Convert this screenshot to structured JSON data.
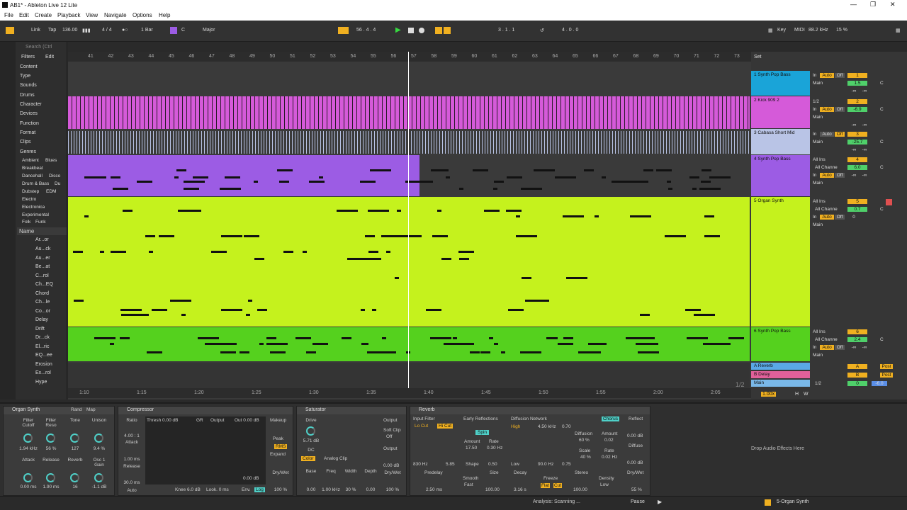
{
  "window": {
    "title": "AB1* - Ableton Live 12 Lite"
  },
  "menu": [
    "File",
    "Edit",
    "Create",
    "Playback",
    "View",
    "Navigate",
    "Options",
    "Help"
  ],
  "control": {
    "link": "Link",
    "tap": "Tap",
    "tempo": "136.00",
    "signature": "4 / 4",
    "quantize": "1 Bar",
    "key": "C",
    "scale": "Major",
    "position": "56 .  4 .  4",
    "loop_start": "3 .  1 .  1",
    "loop_length": "4 .  0 .  0",
    "key_btn": "Key",
    "midi": "MIDI",
    "sample_rate": "88.2 kHz",
    "cpu": "15 %"
  },
  "browser": {
    "search": "Search (Ctrl",
    "filters": "Filters",
    "edit": "Edit",
    "categories": [
      "Content",
      "Type",
      "Sounds",
      "Drums",
      "Character",
      "Devices",
      "Function",
      "Format",
      "Clips",
      "Genres"
    ],
    "genres": [
      "Ambient",
      "Blues",
      "Breakbeat",
      "Dancehall",
      "Disco",
      "Drum & Bass",
      "Du",
      "Dubstep",
      "EDM",
      "Electro",
      "Electronica",
      "Experimental",
      "Folk",
      "Funk"
    ],
    "name_header": "Name",
    "items": [
      "Ar...or",
      "Au...ck",
      "Au...er",
      "Be...at",
      "C...rol",
      "Ch...EQ",
      "Chord",
      "Ch...le",
      "Co...or",
      "Delay",
      "Drift",
      "Dr...ck",
      "El...ric",
      "EQ...ee",
      "Erosion",
      "Ex...rol",
      "Hype"
    ]
  },
  "ruler": [
    "41",
    "42",
    "43",
    "44",
    "45",
    "46",
    "47",
    "48",
    "49",
    "50",
    "51",
    "52",
    "53",
    "54",
    "55",
    "56",
    "57",
    "58",
    "59",
    "60",
    "61",
    "62",
    "63",
    "64",
    "65",
    "66",
    "67",
    "68",
    "69",
    "70",
    "71",
    "72",
    "73"
  ],
  "time_ruler": [
    "1:10",
    "1:15",
    "1:20",
    "1:25",
    "1:30",
    "1:35",
    "1:40",
    "1:45",
    "1:50",
    "1:55",
    "2:00",
    "2:05"
  ],
  "page_indicator": "1/2",
  "set_label": "Set",
  "tracks": [
    {
      "num": "1",
      "name": "1 Synth Pop Bass",
      "color": "#1aa4d8",
      "input": "In",
      "auto": "Auto",
      "off": "Off",
      "vol": "1.5",
      "pan": "C",
      "route": "Main",
      "inf1": "-∞",
      "inf2": "-∞"
    },
    {
      "num": "2",
      "name": "2 Kick 909 2",
      "color": "#d55ad9",
      "input": "1/2",
      "auto": "Auto",
      "off": "Off",
      "vol": "-6.9",
      "pan": "C",
      "route": "Main",
      "in": "In",
      "inf1": "-∞",
      "inf2": "-∞"
    },
    {
      "num": "3",
      "name": "3 Cabasa Short Mid",
      "color": "#b9c4e6",
      "input": "In",
      "auto": "Auto",
      "off": "Off",
      "vol": "-25.7",
      "pan": "C",
      "route": "Main",
      "inf1": "-∞",
      "inf2": "-∞"
    },
    {
      "num": "4",
      "name": "4 Synth Pop Bass",
      "color": "#9c5ce4",
      "input": "All Ins",
      "channel": "All Channe",
      "auto": "Auto",
      "off": "Off",
      "vol": "6.0",
      "pan": "C",
      "route": "Main",
      "in": "In",
      "inf1": "-∞",
      "inf2": "-∞"
    },
    {
      "num": "5",
      "name": "5 Organ Synth",
      "color": "#c5f21d",
      "input": "All Ins",
      "channel": "All Channe",
      "auto": "Auto",
      "off": "Off",
      "vol": "0.7",
      "pan": "C",
      "route": "Main",
      "in": "In",
      "inf1": "0"
    },
    {
      "num": "6",
      "name": "6 Synth Pop Bass",
      "color": "#55d11e",
      "input": "All Ins",
      "channel": "All Channe",
      "auto": "Auto",
      "off": "Off",
      "vol": "2.4",
      "pan": "C",
      "route": "Main",
      "in": "In",
      "inf1": "-∞",
      "inf2": "-∞"
    }
  ],
  "returns": [
    {
      "name": "A Reverb",
      "letter": "A",
      "color": "#5aa8e6",
      "post": "Post"
    },
    {
      "name": "B Delay",
      "letter": "B",
      "color": "#e0609a",
      "post": "Post"
    }
  ],
  "master": {
    "name": "Main",
    "route": "1/2",
    "vol": "0",
    "pan": "-6.0",
    "zoom": "1.00x",
    "h": "H",
    "w": "W"
  },
  "devices": {
    "rack": {
      "title": "Organ Synth",
      "rand": "Rand",
      "map": "Map",
      "macros": [
        {
          "l": "Filter Cutoff",
          "v": "1.94 kHz"
        },
        {
          "l": "Filter Reso",
          "v": "56 %"
        },
        {
          "l": "Tone",
          "v": "127"
        },
        {
          "l": "Unison",
          "v": "9.4 %"
        },
        {
          "l": "Attack",
          "v": "0.00 ms"
        },
        {
          "l": "Release",
          "v": "1.90 ms"
        },
        {
          "l": "Reverb",
          "v": "16"
        },
        {
          "l": "Osc 1 Gain",
          "v": "-1.1 dB"
        }
      ]
    },
    "compressor": {
      "title": "Compressor",
      "ratio_l": "Ratio",
      "ratio": "4.00 : 1",
      "attack_l": "Attack",
      "attack": "1.00 ms",
      "release_l": "Release",
      "release": "30.0 ms",
      "auto": "Auto",
      "thresh": "Thresh 0.00 dB",
      "gr": "GR",
      "output": "Output",
      "out": "Out 0.00 dB",
      "makeup": "Makeup",
      "peak": "Peak",
      "rms": "RMS",
      "expand": "Expand",
      "knee": "Knee 6.0 dB",
      "look": "Look. 0 ms",
      "env": "Env.",
      "log": "Log",
      "drywet_l": "Dry/Wet",
      "drywet": "100 %",
      "level": "0.00 dB"
    },
    "saturator": {
      "title": "Saturator",
      "drive_l": "Drive",
      "drive": "5.71 dB",
      "dc": "DC",
      "color": "Color",
      "mode": "Analog Clip",
      "output_l": "Output",
      "softclip": "Soft Clip",
      "off": "Off",
      "output": "0.00 dB",
      "base_l": "Base",
      "base": "0.00",
      "freq_l": "Freq",
      "freq": "1.00 kHz",
      "width_l": "Width",
      "width": "30 %",
      "depth_l": "Depth",
      "depth": "0.00",
      "drywet_l": "Dry/Wet",
      "drywet": "100 %"
    },
    "reverb": {
      "title": "Reverb",
      "input_filter": "Input Filter",
      "locut": "Lo Cut",
      "hicut": "Hi Cut",
      "hz": "830 Hz",
      "q": "5.85",
      "early": "Early Reflections",
      "spin": "Spin",
      "amount_l": "Amount",
      "amount": "17.50",
      "rate_l": "Rate",
      "rate": "0.30 Hz",
      "shape_l": "Shape",
      "shape": "0.50",
      "diffusion_net": "Diffusion Network",
      "high": "High",
      "hz2": "4.50 kHz",
      "v070": "0.70",
      "low": "Low",
      "hz3": "90.0 Hz",
      "v075": "0.75",
      "diffusion_l": "Diffusion",
      "diffusion": "60 %",
      "scale_l": "Scale",
      "scale": "40 %",
      "chorus": "Chorus",
      "camount_l": "Amount",
      "camount": "0.02",
      "crate_l": "Rate",
      "crate": "0.02 Hz",
      "reflect_l": "Reflect",
      "reflect": "0.00 dB",
      "diffuse_l": "Diffuse",
      "diffuse": "0.00 dB",
      "predelay_l": "Predelay",
      "predelay": "2.50 ms",
      "smooth_l": "Smooth",
      "smooth": "Fast",
      "size_l": "Size",
      "size": "100.00",
      "decay_l": "Decay",
      "decay": "3.16 s",
      "freeze": "Freeze",
      "flat": "Flat",
      "cut": "Cut",
      "stereo_l": "Stereo",
      "stereo": "100.00",
      "density_l": "Density",
      "density": "Low",
      "drywet_l": "Dry/Wet",
      "drywet": "55 %"
    },
    "drop": "Drop Audio Effects Here"
  },
  "status": {
    "analysis": "Analysis: Scanning ...",
    "pause": "Pause",
    "track": "5-Organ Synth"
  }
}
